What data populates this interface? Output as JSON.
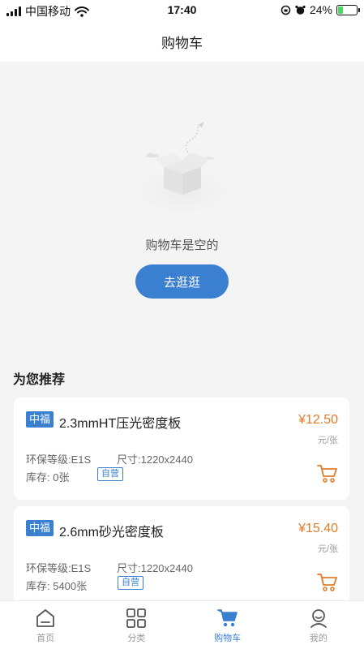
{
  "status": {
    "carrier": "中国移动",
    "time": "17:40",
    "battery": "24%"
  },
  "header": {
    "title": "购物车"
  },
  "empty": {
    "message": "购物车是空的",
    "button_label": "去逛逛"
  },
  "recommend": {
    "title": "为您推荐",
    "products": [
      {
        "brand": "中福",
        "name": "2.3mmHT压光密度板",
        "price": "¥12.50",
        "unit": "元/张",
        "grade": "环保等级:E1S",
        "size": "尺寸:1220x2440",
        "stock": "库存: 0张",
        "tag": "自营"
      },
      {
        "brand": "中福",
        "name": "2.6mm砂光密度板",
        "price": "¥15.40",
        "unit": "元/张",
        "grade": "环保等级:E1S",
        "size": "尺寸:1220x2440",
        "stock": "库存: 5400张",
        "tag": "自营"
      }
    ]
  },
  "tabs": [
    {
      "label": "首页",
      "icon": "home-icon"
    },
    {
      "label": "分类",
      "icon": "grid-icon"
    },
    {
      "label": "购物车",
      "icon": "cart-icon",
      "active": true
    },
    {
      "label": "我的",
      "icon": "user-icon"
    }
  ],
  "colors": {
    "accent": "#3a7fd0",
    "price": "#e07b2a",
    "background": "#f4f4f4"
  }
}
